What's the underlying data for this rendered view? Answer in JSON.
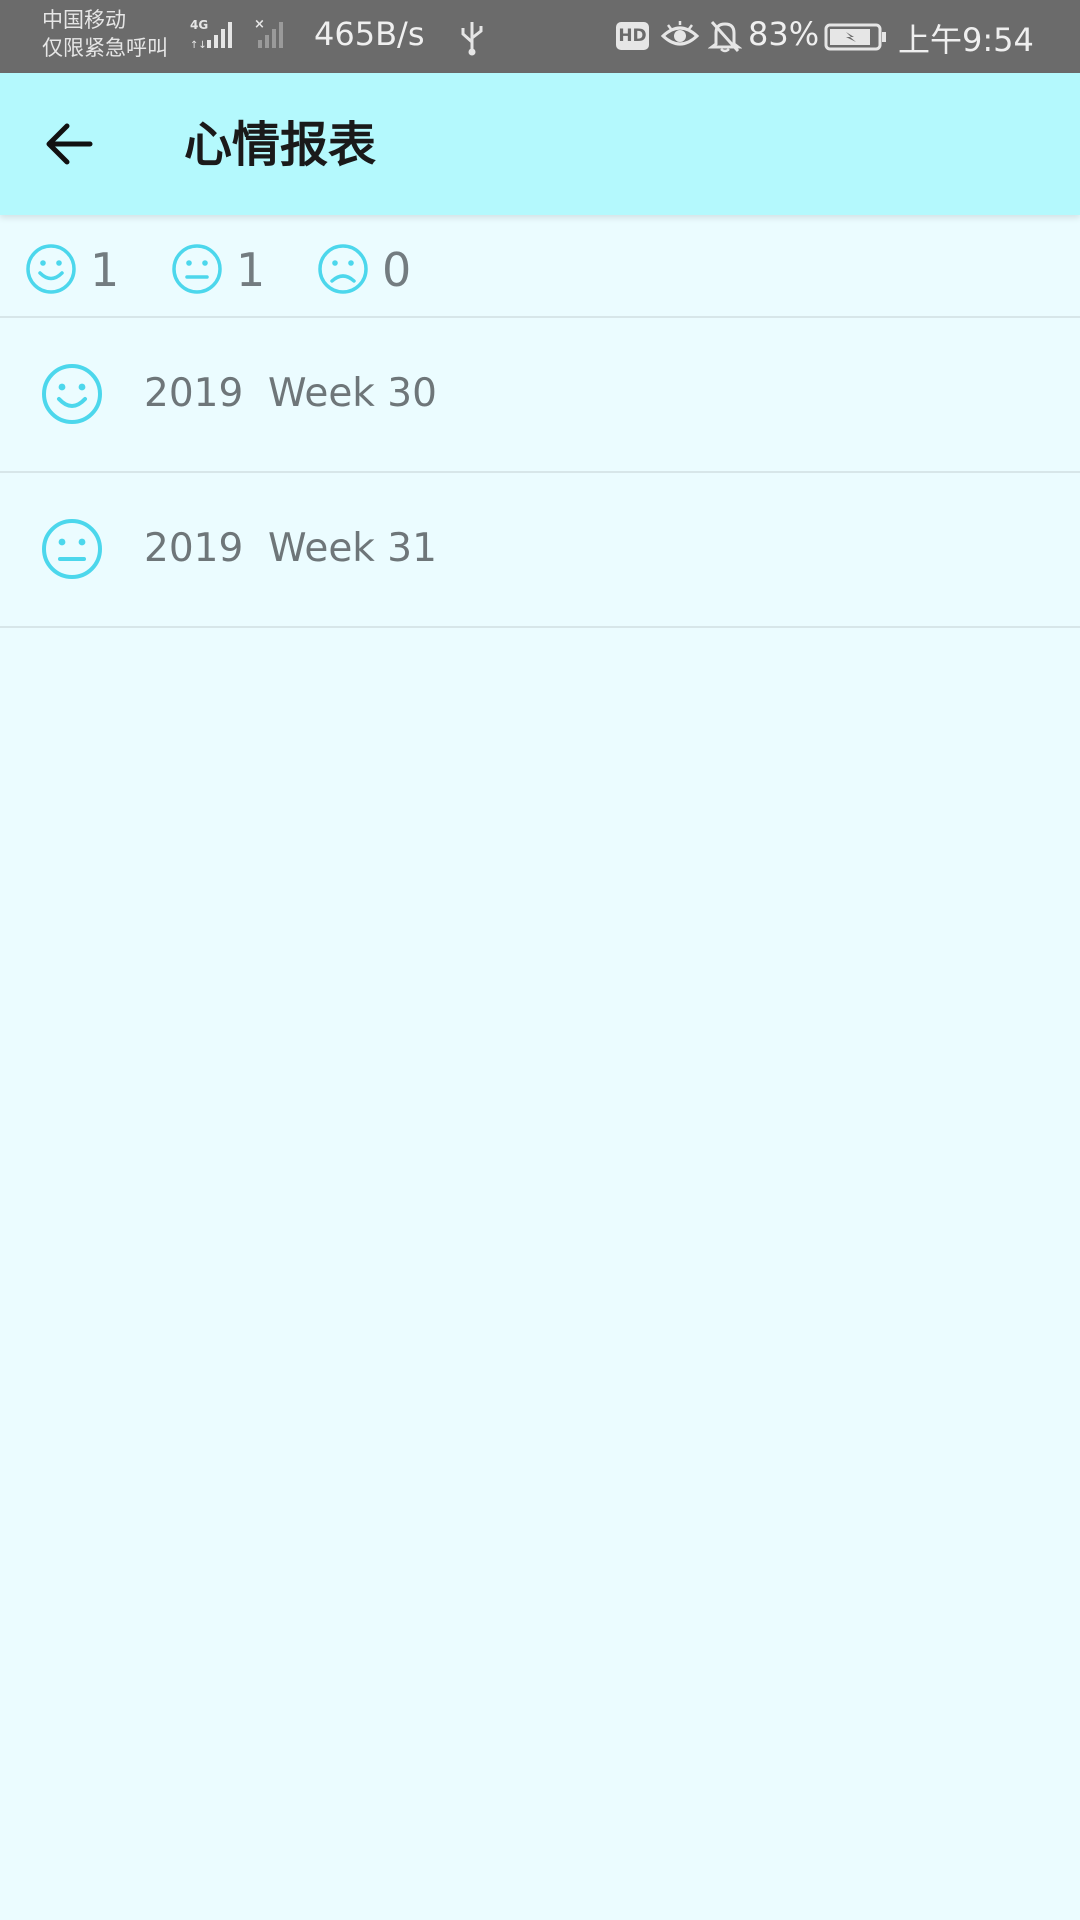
{
  "status_bar": {
    "carrier_line1": "中国移动",
    "carrier_line2": "仅限紧急呼叫",
    "network_type": "4G",
    "net_speed": "465B/s",
    "hd_label": "HD",
    "battery_percent": "83%",
    "time": "上午9:54",
    "icons": [
      "signal-bars-icon",
      "no-signal-icon",
      "usb-icon",
      "eye-icon",
      "bell-off-icon",
      "battery-charging-icon"
    ]
  },
  "app_bar": {
    "title": "心情报表",
    "background": "#b4f9fd"
  },
  "summary": {
    "happy_count": "1",
    "neutral_count": "1",
    "sad_count": "0",
    "icon_color": "#4cd7ec"
  },
  "weeks": [
    {
      "mood": "happy",
      "label": "2019  Week 30"
    },
    {
      "mood": "neutral",
      "label": "2019  Week 31"
    }
  ]
}
